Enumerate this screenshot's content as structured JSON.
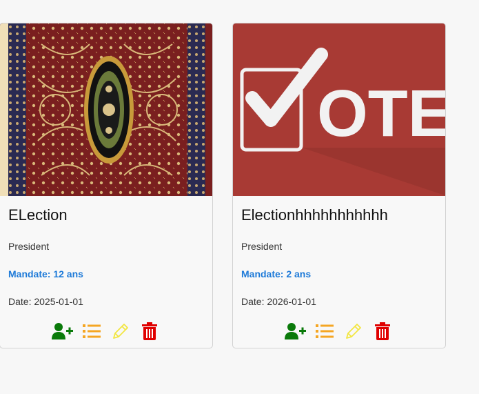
{
  "cards": [
    {
      "title": "ELection",
      "type": "President",
      "mandate": "Mandate: 12 ans",
      "date": "Date: 2025-01-01",
      "image": "ornate-carpet-pattern"
    },
    {
      "title": "Electionhhhhhhhhhhh",
      "type": "President",
      "mandate": "Mandate: 2 ans",
      "date": "Date: 2026-01-01",
      "image": "vote-checkbox",
      "image_text": "OTE"
    }
  ],
  "actions": [
    {
      "icon": "add-user-icon",
      "color": "#0a7a0a"
    },
    {
      "icon": "list-icon",
      "color": "#f5a623"
    },
    {
      "icon": "pencil-icon",
      "color": "#f5e642"
    },
    {
      "icon": "trash-icon",
      "color": "#e00000"
    }
  ],
  "colors": {
    "mandate": "#1e7ad8",
    "vote_bg": "#a83a34"
  }
}
